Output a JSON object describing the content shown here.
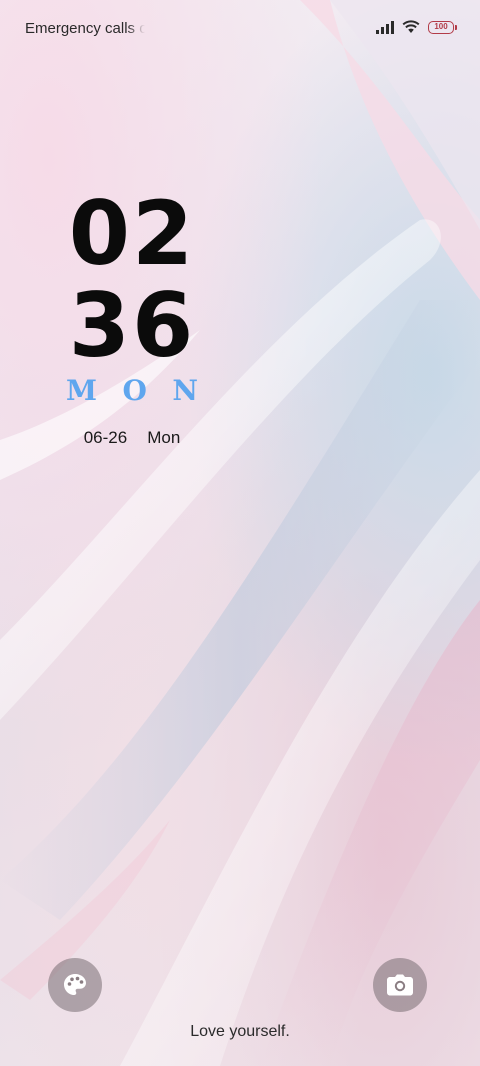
{
  "status_bar": {
    "carrier_text": "Emergency calls o",
    "battery_level": "100",
    "icons": [
      "signal-icon",
      "wifi-icon",
      "battery-icon"
    ]
  },
  "clock": {
    "hours": "02",
    "minutes": "36",
    "weekday_letters": [
      "M",
      "O",
      "N"
    ],
    "date": "06-26",
    "weekday": "Mon"
  },
  "shortcuts": {
    "left_icon": "palette-icon",
    "right_icon": "camera-icon"
  },
  "footer": {
    "text": "Love yourself."
  },
  "colors": {
    "weekday_accent": "#5fa6ee",
    "battery": "#b23b48",
    "clock": "#0b0b0b"
  }
}
